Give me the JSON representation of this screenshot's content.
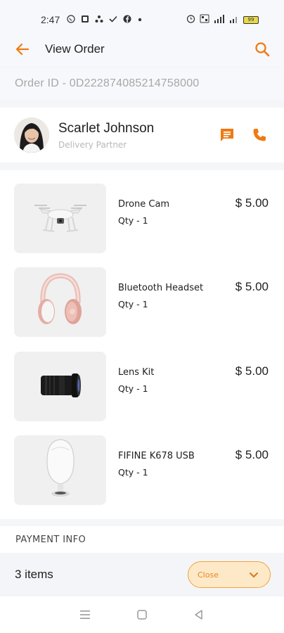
{
  "status_bar": {
    "time": "2:47",
    "left_icons": [
      "whatsapp-icon",
      "gallery-icon",
      "share-icon",
      "check-icon",
      "facebook-icon",
      "dot-icon"
    ],
    "right_icons": [
      "alarm-icon",
      "volte-icon",
      "signal-icon",
      "signal-icon",
      "battery-icon"
    ],
    "battery_level": "99"
  },
  "header": {
    "title": "View Order",
    "back_icon": "arrow-left-icon",
    "search_icon": "search-icon"
  },
  "order": {
    "id_text": "Order ID - 0D222874085214758000"
  },
  "partner": {
    "name": "Scarlet Johnson",
    "role": "Delivery Partner",
    "message_icon": "message-icon",
    "call_icon": "phone-icon"
  },
  "items": [
    {
      "name": "Drone Cam",
      "qty": "Qty - 1",
      "price": "$ 5.00",
      "icon": "drone-icon"
    },
    {
      "name": "Bluetooth Headset",
      "qty": "Qty - 1",
      "price": "$ 5.00",
      "icon": "headphones-icon"
    },
    {
      "name": "Lens Kit",
      "qty": "Qty - 1",
      "price": "$ 5.00",
      "icon": "camera-lens-icon"
    },
    {
      "name": "FIFINE K678 USB",
      "qty": "Qty - 1",
      "price": "$ 5.00",
      "icon": "speaker-icon"
    }
  ],
  "payment": {
    "heading": "PAYMENT INFO"
  },
  "footer": {
    "items_count": "3 items",
    "close_label": "Close",
    "close_icon": "chevron-down-icon"
  },
  "nav": {
    "icons": [
      "menu-icon",
      "home-square-icon",
      "back-triangle-icon"
    ]
  },
  "colors": {
    "accent": "#f07a12",
    "close_bg": "#fde9c8",
    "text_muted": "#a8a8a8"
  }
}
